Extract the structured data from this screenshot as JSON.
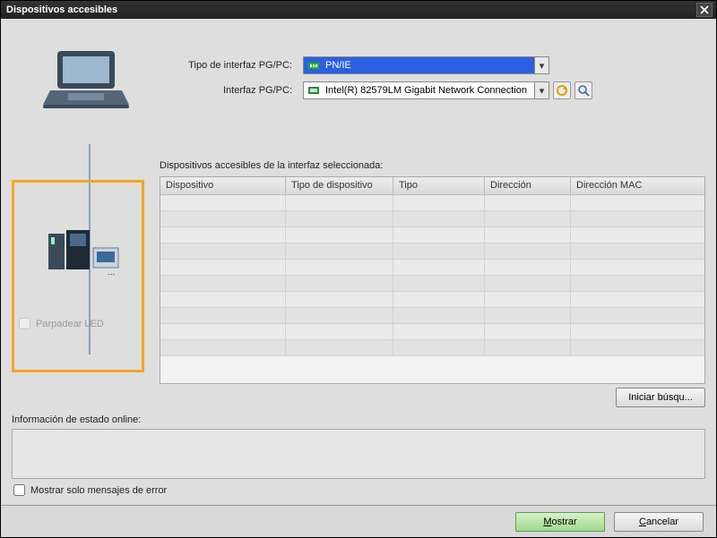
{
  "window": {
    "title": "Dispositivos accesibles"
  },
  "config": {
    "label_interface_type": "Tipo de interfaz PG/PC:",
    "interface_type_value": "PN/IE",
    "label_interface": "Interfaz PG/PC:",
    "interface_value": "Intel(R) 82579LM Gigabit Network Connection"
  },
  "icons": {
    "laptop": "laptop-icon",
    "devices": "plc-hmi-icon",
    "refresh": "refresh-icon",
    "search": "search-icon",
    "net_green": "network-icon"
  },
  "table": {
    "title": "Dispositivos accesibles de la interfaz seleccionada:",
    "columns": [
      "Dispositivo",
      "Tipo de dispositivo",
      "Tipo",
      "Dirección",
      "Dirección MAC"
    ],
    "rows": [
      [
        "",
        "",
        "",
        "",
        ""
      ],
      [
        "",
        "",
        "",
        "",
        ""
      ],
      [
        "",
        "",
        "",
        "",
        ""
      ],
      [
        "",
        "",
        "",
        "",
        ""
      ],
      [
        "",
        "",
        "",
        "",
        ""
      ],
      [
        "",
        "",
        "",
        "",
        ""
      ],
      [
        "",
        "",
        "",
        "",
        ""
      ],
      [
        "",
        "",
        "",
        "",
        ""
      ],
      [
        "",
        "",
        "",
        "",
        ""
      ],
      [
        "",
        "",
        "",
        "",
        ""
      ]
    ]
  },
  "led": {
    "label": "Parpadear LED"
  },
  "search_btn": "Iniciar búsqu...",
  "status": {
    "label": "Información de estado online:"
  },
  "errors_only": "Mostrar solo mensajes de error",
  "footer": {
    "show": "Mostrar",
    "cancel": "Cancelar"
  }
}
